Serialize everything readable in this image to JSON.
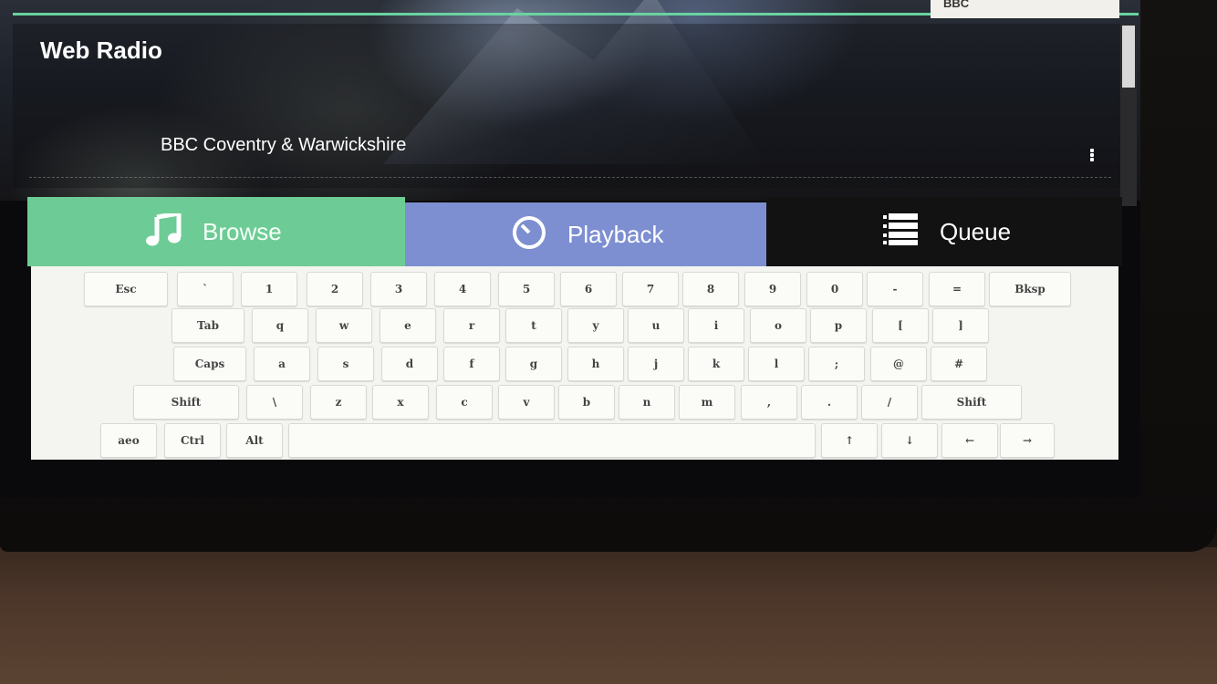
{
  "app": {
    "page_title": "Web Radio",
    "top_tile_text": "BBC",
    "list_item": "BBC Coventry & Warwickshire"
  },
  "tabs": [
    {
      "label": "Browse",
      "icon": "music-note-icon",
      "active": true
    },
    {
      "label": "Playback",
      "icon": "clock-icon",
      "active": false
    },
    {
      "label": "Queue",
      "icon": "list-icon",
      "active": false
    }
  ],
  "keyboard": {
    "rows": [
      [
        "Esc",
        "`",
        "1",
        "2",
        "3",
        "4",
        "5",
        "6",
        "7",
        "8",
        "9",
        "0",
        "-",
        "=",
        "Bksp"
      ],
      [
        "Tab",
        "q",
        "w",
        "e",
        "r",
        "t",
        "y",
        "u",
        "i",
        "o",
        "p",
        "[",
        "]"
      ],
      [
        "Caps",
        "a",
        "s",
        "d",
        "f",
        "g",
        "h",
        "j",
        "k",
        "l",
        ";",
        "@",
        "#"
      ],
      [
        "Shift",
        "\\",
        "z",
        "x",
        "c",
        "v",
        "b",
        "n",
        "m",
        ",",
        ".",
        "/",
        "Shift"
      ],
      [
        "aeo",
        "Ctrl",
        "Alt",
        "",
        "↑",
        "↓",
        "←",
        "→"
      ]
    ]
  },
  "colors": {
    "browse_tab": "#6dcc95",
    "playback_tab": "#7d8fd0",
    "queue_tab": "#121212",
    "accent_line": "#6ad3a2"
  }
}
